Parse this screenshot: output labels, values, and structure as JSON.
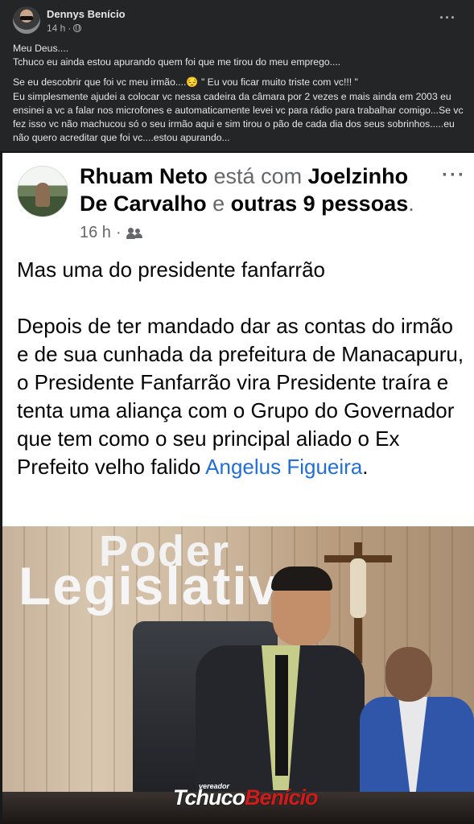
{
  "outer_post": {
    "author": "Dennys Benício",
    "time": "14 h",
    "paragraphs": [
      "Meu Deus....\nTchuco eu ainda estou apurando quem foi que me tirou do meu emprego....",
      "Se eu descobrir que foi vc meu irmão....😔 \" Eu vou ficar muito triste com vc!!! \"\nEu simplesmente ajudei a colocar vc nessa cadeira da câmara por 2 vezes e mais ainda em 2003 eu ensinei a vc a falar nos microfones e automaticamente levei vc para rádio para trabalhar comigo...Se vc fez isso vc não machucou só o seu irmão aqui e sim tirou o pão de cada dia dos seus sobrinhos.....eu não quero acreditar que foi vc....estou apurando..."
    ],
    "more_icon": "more-horizontal-icon",
    "privacy_icon": "globe-icon"
  },
  "shared_post": {
    "author": "Rhuam Neto",
    "with_text": "está com",
    "tagged": "Joelzinho De Carvalho",
    "and_text": "e",
    "others": "outras 9 pessoas",
    "period": ".",
    "time": "16 h",
    "audience_icon": "friends-icon",
    "body_line1": "Mas uma do presidente fanfarrão",
    "body_line2": "Depois de ter mandado dar as contas do irmão e de sua cunhada da prefeitura de Manacapuru, o Presidente Fanfarrão vira Presidente traíra e tenta uma aliança com o Grupo do Governador que tem como o seu principal aliado o Ex Prefeito velho falido",
    "link_text": "Angelus Figueira",
    "link_after": "."
  },
  "photo": {
    "wall_text_1": "Poder",
    "wall_text_2": "Legislativ",
    "watermark_small": "vereador",
    "watermark_a": "Tchuco",
    "watermark_b": "Benício"
  }
}
